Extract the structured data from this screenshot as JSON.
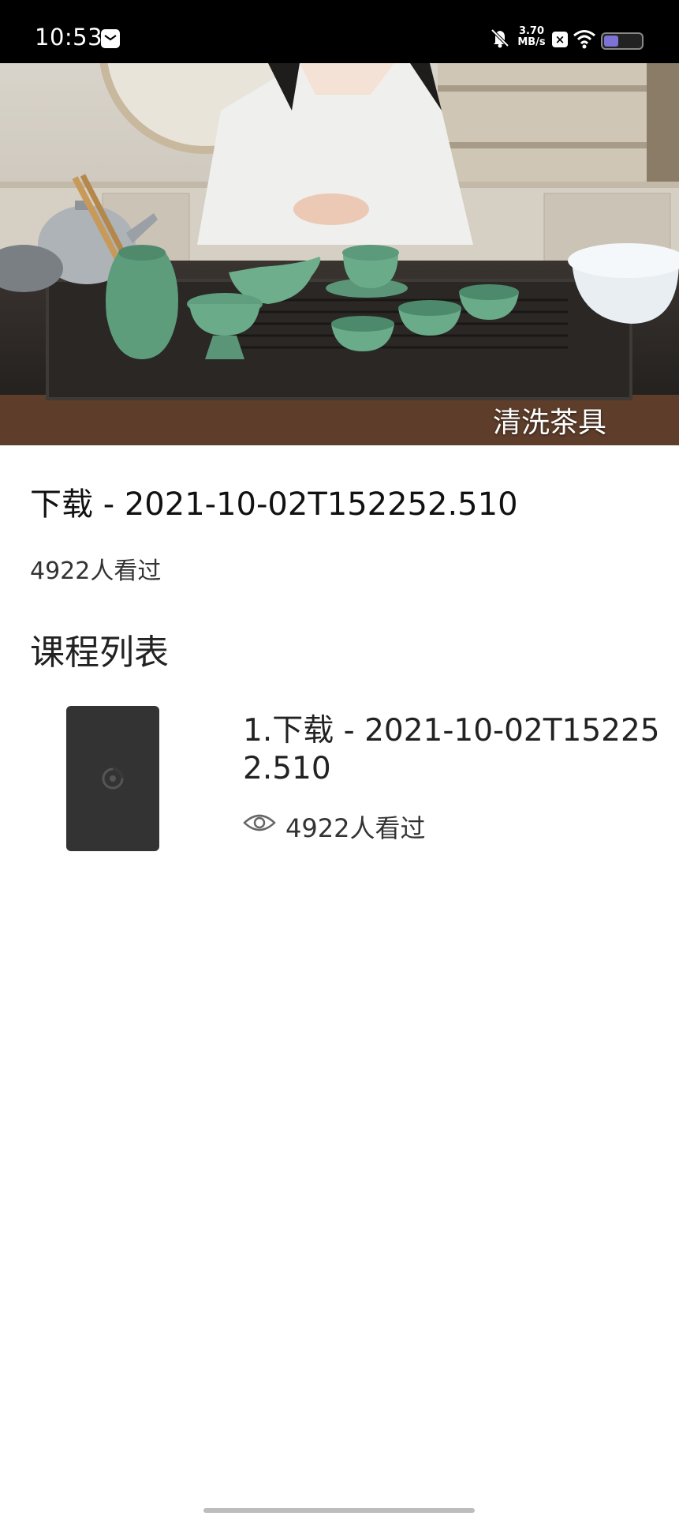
{
  "status_bar": {
    "time": "10:53",
    "net_speed_value": "3.70",
    "net_speed_unit": "MB/s",
    "battery_level": 0.4,
    "icons": [
      "message-icon",
      "mute-icon",
      "x-icon",
      "wifi-icon",
      "battery-icon"
    ]
  },
  "video": {
    "caption": "清洗茶具"
  },
  "detail": {
    "title": "下载 - 2021-10-02T152252.510",
    "view_count": "4922人看过"
  },
  "course_list": {
    "heading": "课程列表",
    "items": [
      {
        "title": "1.下载 - 2021-10-02T152252.510",
        "views": "4922人看过"
      }
    ]
  },
  "colors": {
    "status_bar_bg": "#000000",
    "battery_fill": "#7d72d6",
    "thumb_bg": "#333333"
  }
}
